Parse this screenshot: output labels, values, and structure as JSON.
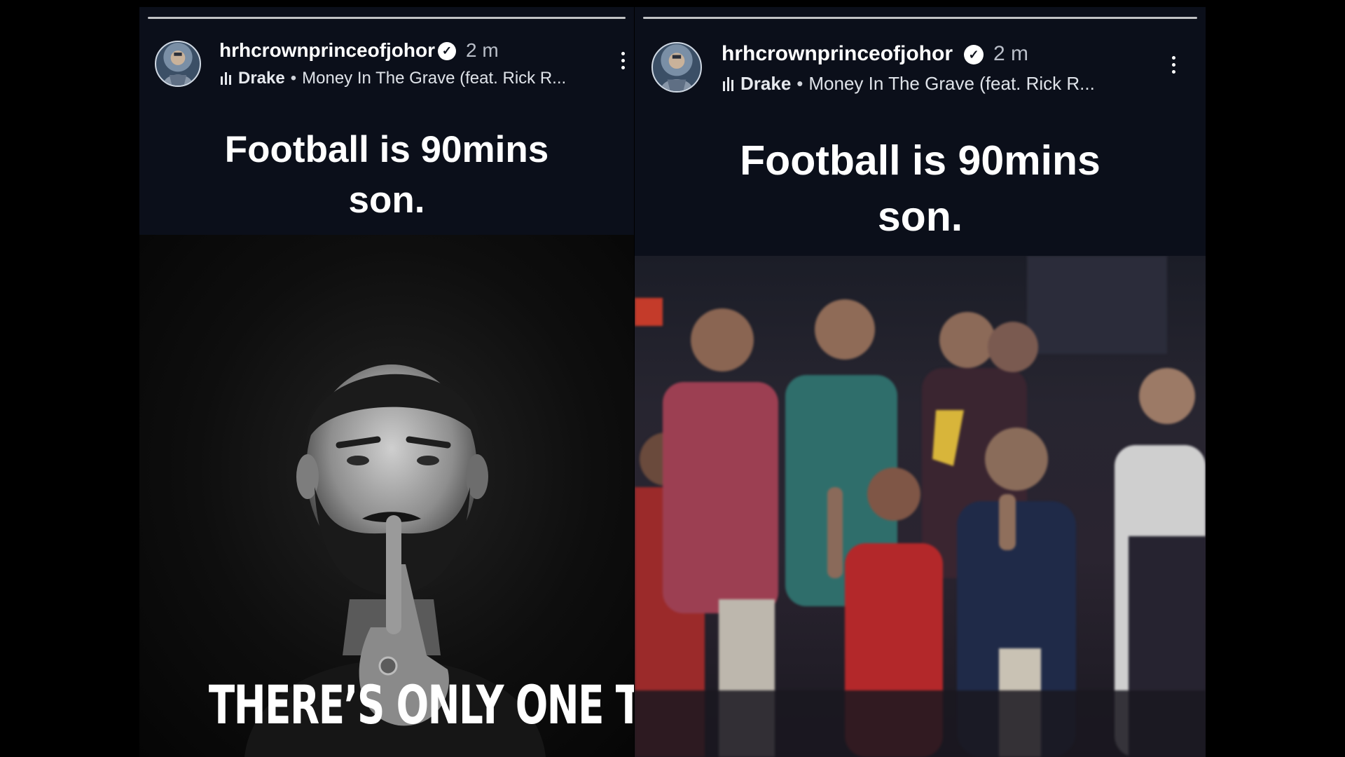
{
  "stories": [
    {
      "username": "hrhcrownprinceofjohor",
      "time": "2 m",
      "music": {
        "artist": "Drake",
        "song": "Money In The Grave (feat. Rick R..."
      },
      "caption": {
        "line1": "Football is 90mins",
        "line2": "son."
      },
      "image_text": "THERE’S ONLY ONE TMJ"
    },
    {
      "username": "hrhcrownprinceofjohor",
      "time": "2 m",
      "music": {
        "artist": "Drake",
        "song": "Money In The Grave (feat. Rick R..."
      },
      "caption": {
        "line1": "Football is 90mins",
        "line2": "son."
      }
    }
  ],
  "icons": {
    "verified": "verified-badge-icon",
    "music": "music-bars-icon",
    "more": "more-options-icon"
  },
  "colors": {
    "background": "#000000",
    "story_background": "#0b0f1a",
    "text": "#ffffff",
    "muted": "#b9bec8"
  }
}
